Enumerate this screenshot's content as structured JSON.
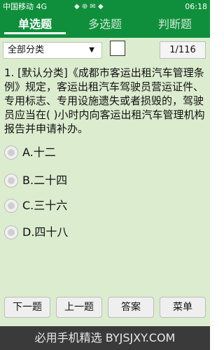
{
  "status": {
    "carrier": "中国移动 4G",
    "time": "06:18"
  },
  "tabs": [
    {
      "label": "单选题",
      "active": true
    },
    {
      "label": "多选题",
      "active": false
    },
    {
      "label": "判断题",
      "active": false
    }
  ],
  "toolbar": {
    "category_selected": "全部分类",
    "counter": "1/116"
  },
  "question": {
    "text": "1. [默认分类]《成都市客运出租汽车管理条例》规定，客运出租汽车驾驶员营运证件、专用标志、专用设施遗失或者损毁的，驾驶员应当在(   )小时内向客运出租汽车管理机构报告并申请补办。"
  },
  "options": [
    {
      "label": "A.十二"
    },
    {
      "label": "B.二十四"
    },
    {
      "label": "C.三十六"
    },
    {
      "label": "D.四十八"
    }
  ],
  "buttons": {
    "prev": "下一题",
    "next": "上一题",
    "answer": "答案",
    "menu": "菜单"
  },
  "footer": {
    "text": "必用手机精选 BYJSJXY.COM"
  }
}
